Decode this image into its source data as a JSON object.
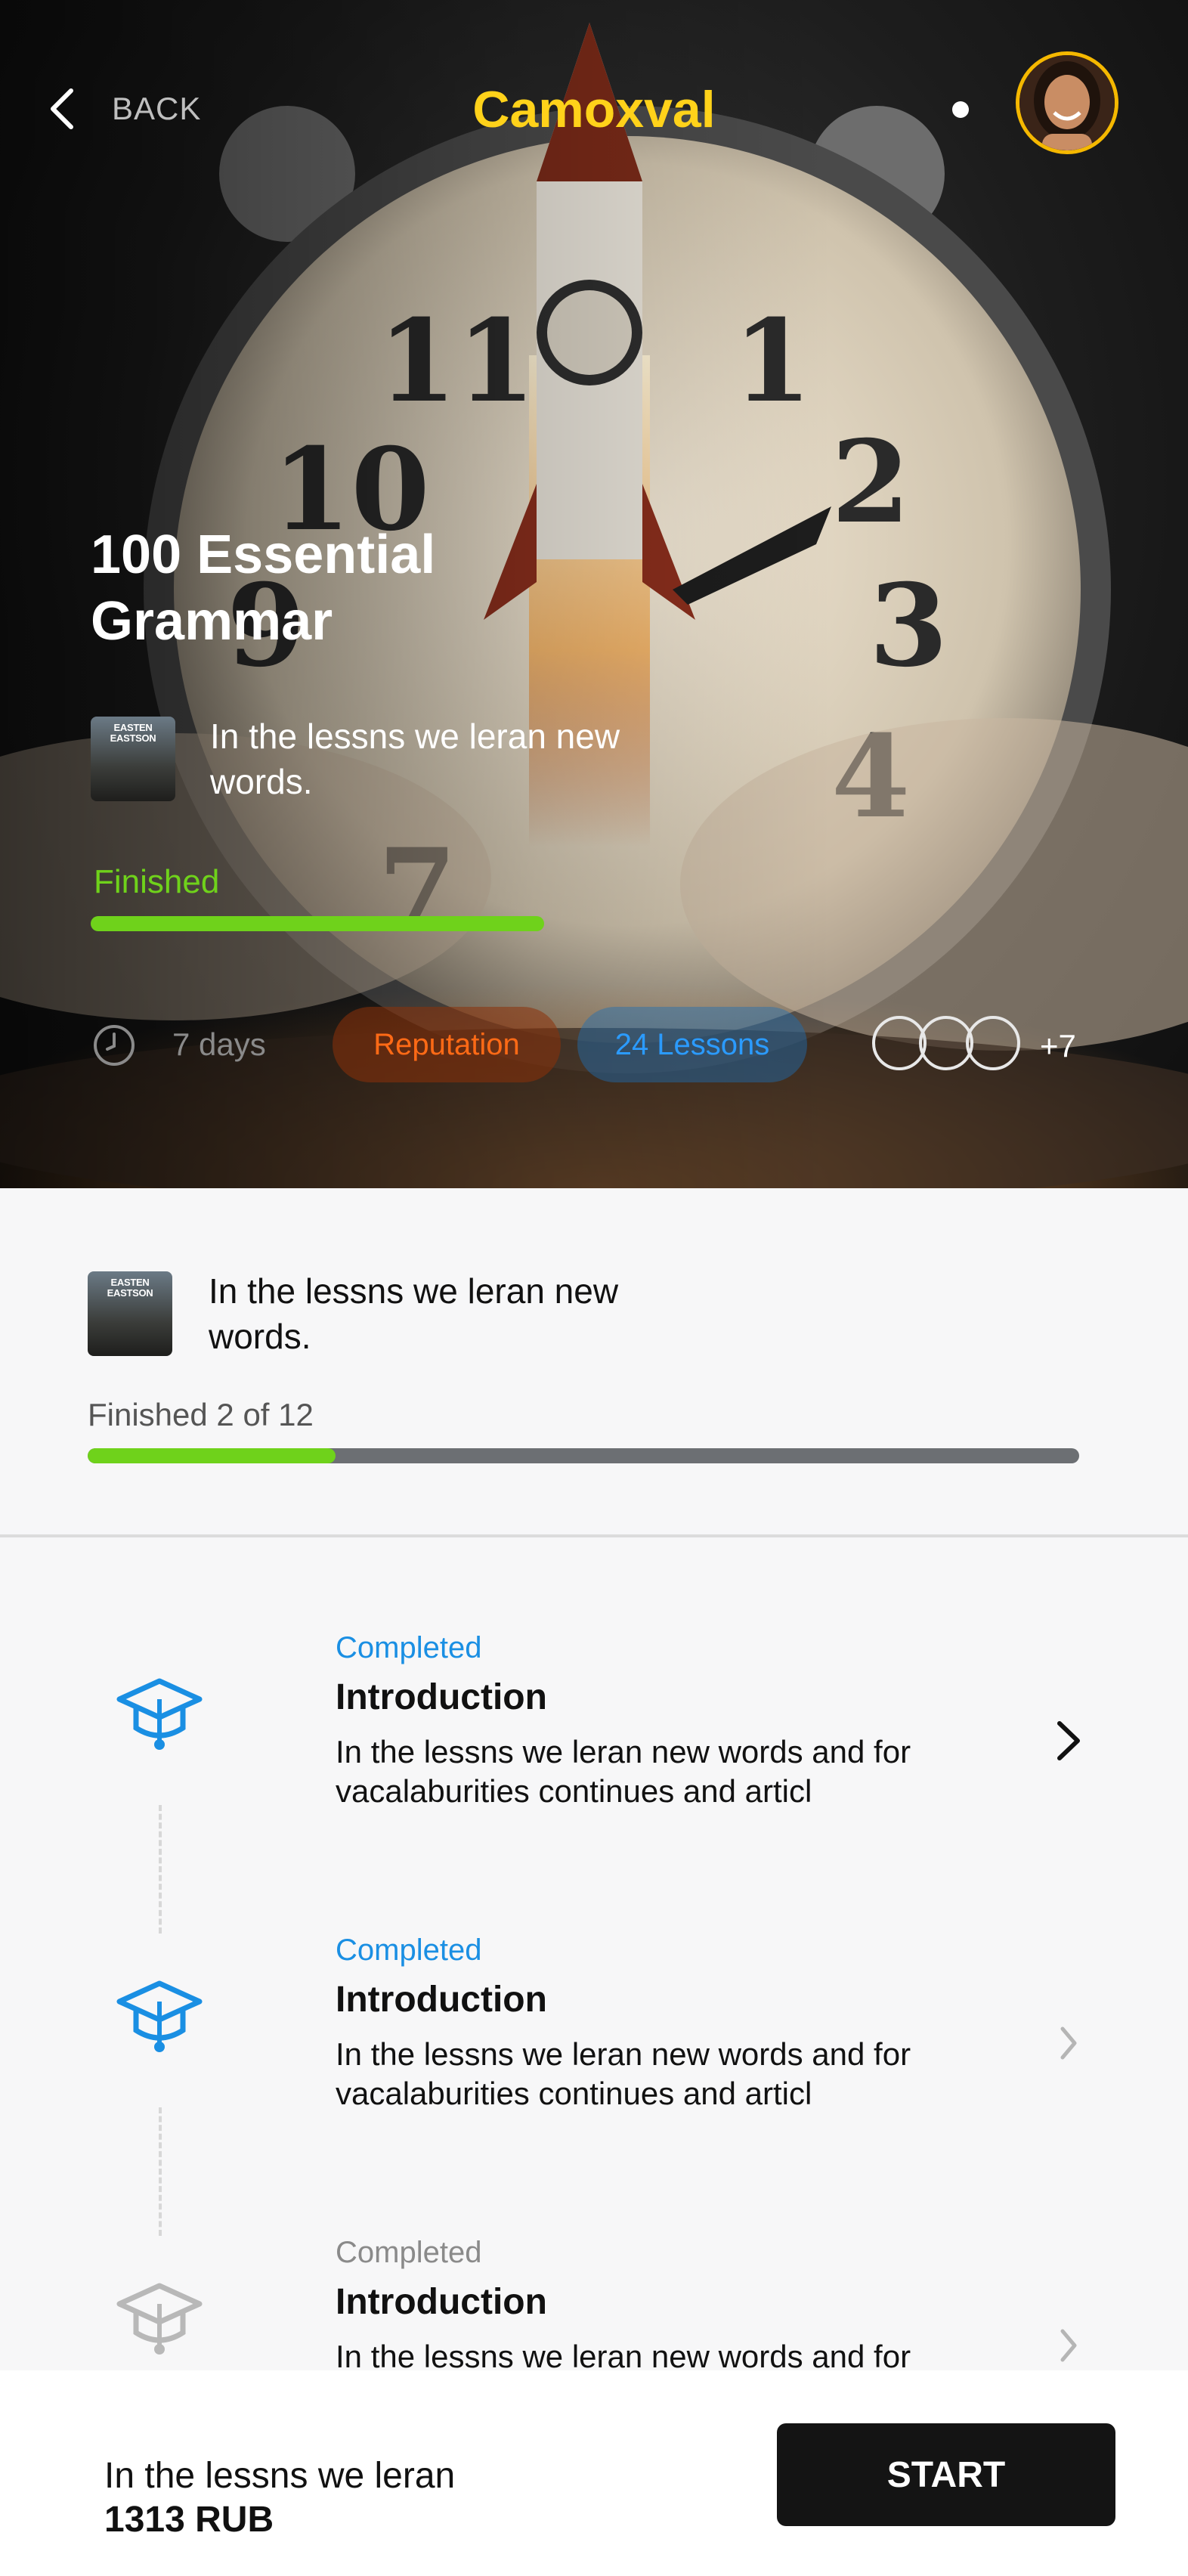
{
  "header": {
    "back_label": "BACK",
    "app_title": "Camoxval",
    "brand_color": "#ffd21a"
  },
  "hero": {
    "title": "100 Essential Grammar",
    "description": "In the lessns we leran new words.",
    "cover_text": "EASTEN EASTSON",
    "progress_label": "Finished",
    "progress_fraction": 1.0,
    "duration": "7 days",
    "tags": [
      "Reputation",
      "24 Lessons"
    ],
    "participants_more": "+7"
  },
  "course_card": {
    "description": "In the lessns we leran new words.",
    "cover_text": "EASTEN EASTSON",
    "progress_label": "Finished 2 of 12",
    "progress_fraction": 0.25
  },
  "lessons": [
    {
      "status": "Completed",
      "title": "Introduction",
      "description": "In the lessns we leran new words and for vacalaburities continues and articl",
      "state": "active"
    },
    {
      "status": "Completed",
      "title": "Introduction",
      "description": "In the lessns we leran new words and for vacalaburities continues and articl",
      "state": "done"
    },
    {
      "status": "Completed",
      "title": "Introduction",
      "description": "In the lessns we leran new words and for vacalaburities continues and articl",
      "state": "locked"
    }
  ],
  "footer": {
    "title": "In the lessns we leran",
    "price": "1313 RUB",
    "start_label": "START"
  },
  "colors": {
    "accent_green": "#6fd21b",
    "accent_blue": "#1a8fe3",
    "accent_orange": "#ff6a16",
    "muted_gray": "#a8a8a8"
  }
}
